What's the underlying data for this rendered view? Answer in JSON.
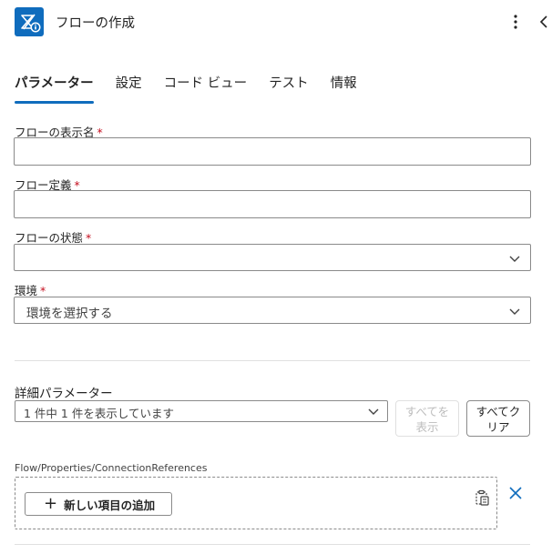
{
  "header": {
    "title": "フローの作成",
    "app_icon": "power-automate-flow-icon",
    "more_icon": "more-vertical-icon",
    "collapse_icon": "chevron-left-icon"
  },
  "tabs": [
    {
      "label": "パラメーター",
      "active": true
    },
    {
      "label": "設定",
      "active": false
    },
    {
      "label": "コード ビュー",
      "active": false
    },
    {
      "label": "テスト",
      "active": false
    },
    {
      "label": "情報",
      "active": false
    }
  ],
  "form": {
    "display_name": {
      "label": "フローの表示名",
      "required": "*",
      "value": ""
    },
    "definition": {
      "label": "フロー定義",
      "required": "*",
      "value": ""
    },
    "state": {
      "label": "フローの状態",
      "required": "*",
      "value": ""
    },
    "environment": {
      "label": "環境",
      "required": "*",
      "value": "環境を選択する"
    }
  },
  "advanced": {
    "label": "詳細パラメーター",
    "select_value": "1 件中 1 件を表示しています",
    "show_all_line1": "すべてを",
    "show_all_line2": "表示",
    "clear_all_line1": "すべてク",
    "clear_all_line2": "リア"
  },
  "connections": {
    "label": "Flow/Properties/ConnectionReferences",
    "add_item": "新しい項目の追加",
    "paste_icon": "paste-icon",
    "remove_icon": "close-icon"
  },
  "colors": {
    "accent": "#0f6cbd",
    "required": "#c50f1f"
  }
}
